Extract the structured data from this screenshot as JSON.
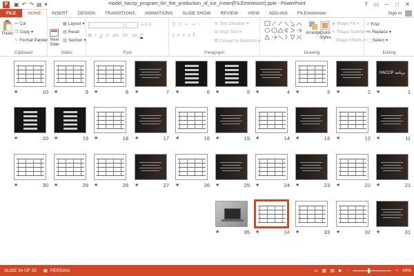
{
  "window": {
    "title": "model_haccp_program_for_the_production_of_ice_cream[FILEminimizer].pptx - PowerPoint",
    "app_icon_letter": "P",
    "qat": [
      "save-icon",
      "undo-icon",
      "redo-icon",
      "start-icon",
      "customize-icon"
    ],
    "controls": [
      "?",
      "▭",
      "─",
      "□",
      "✕"
    ]
  },
  "tabs": [
    "FILE",
    "HOME",
    "INSERT",
    "DESIGN",
    "TRANSITIONS",
    "ANIMATIONS",
    "SLIDE SHOW",
    "REVIEW",
    "VIEW",
    "ADD-INS",
    "FILEminimizer"
  ],
  "active_tab": "HOME",
  "sign_in": "Sign in",
  "ribbon": {
    "clipboard": {
      "label": "Clipboard",
      "paste": "Paste",
      "cut": "Cut",
      "copy": "Copy",
      "format_painter": "Format Painter"
    },
    "slides": {
      "label": "Slides",
      "new_slide": "New",
      "new_slide_2": "Slide",
      "layout": "Layout",
      "reset": "Reset",
      "section": "Section"
    },
    "font": {
      "label": "Font",
      "bold": "B",
      "italic": "I",
      "underline": "U",
      "strike": "S",
      "shadow": "abc",
      "spacing": "AV",
      "case": "Aa",
      "grow": "A",
      "shrink": "A",
      "clear": "A",
      "color": "A"
    },
    "paragraph": {
      "label": "Paragraph",
      "text_direction": "Text Direction",
      "align_text": "Align Text",
      "convert_smartart": "Convert to SmartArt"
    },
    "drawing": {
      "label": "Drawing",
      "arrange": "Arrange",
      "quick_styles": "Quick",
      "quick_styles_2": "Styles",
      "shape_fill": "Shape Fill",
      "shape_outline": "Shape Outline",
      "shape_effects": "Shape Effects"
    },
    "editing": {
      "label": "Editing",
      "find": "Find",
      "replace": "Replace",
      "select": "Select"
    }
  },
  "slides": [
    {
      "n": "1",
      "style": "dark-title",
      "title": "HACCP برنامه"
    },
    {
      "n": "2",
      "style": "dark-text"
    },
    {
      "n": "3",
      "style": "light-table"
    },
    {
      "n": "4",
      "style": "dark-text"
    },
    {
      "n": "5",
      "style": "dark-table"
    },
    {
      "n": "6",
      "style": "dark-table"
    },
    {
      "n": "7",
      "style": "dark-text"
    },
    {
      "n": "8",
      "style": "light-table"
    },
    {
      "n": "9",
      "style": "light-table"
    },
    {
      "n": "10",
      "style": "light-table"
    },
    {
      "n": "11",
      "style": "dark-text"
    },
    {
      "n": "12",
      "style": "light-table"
    },
    {
      "n": "13",
      "style": "dark-text"
    },
    {
      "n": "14",
      "style": "light-table"
    },
    {
      "n": "15",
      "style": "dark-text"
    },
    {
      "n": "16",
      "style": "light-table"
    },
    {
      "n": "17",
      "style": "dark-text"
    },
    {
      "n": "18",
      "style": "light-table"
    },
    {
      "n": "19",
      "style": "dark-table"
    },
    {
      "n": "20",
      "style": "dark-table"
    },
    {
      "n": "21",
      "style": "dark-text"
    },
    {
      "n": "22",
      "style": "light-table"
    },
    {
      "n": "23",
      "style": "dark-text"
    },
    {
      "n": "24",
      "style": "light-table"
    },
    {
      "n": "25",
      "style": "dark-text"
    },
    {
      "n": "26",
      "style": "light-table"
    },
    {
      "n": "27",
      "style": "dark-text"
    },
    {
      "n": "28",
      "style": "light-table"
    },
    {
      "n": "29",
      "style": "light-table"
    },
    {
      "n": "30",
      "style": "light-table"
    },
    {
      "n": "31",
      "style": "dark-text"
    },
    {
      "n": "32",
      "style": "light-table"
    },
    {
      "n": "33",
      "style": "light-table"
    },
    {
      "n": "34",
      "style": "light-table",
      "selected": true
    },
    {
      "n": "35",
      "style": "photo"
    }
  ],
  "status": {
    "slide_info": "SLIDE 34 OF 35",
    "language": "PERSIAN",
    "zoom_minus": "−",
    "zoom_plus": "+",
    "zoom": "40%",
    "zoom_fraction": 0.4
  },
  "colors": {
    "accent": "#d24726",
    "selected_slide_border": "#d24726"
  }
}
